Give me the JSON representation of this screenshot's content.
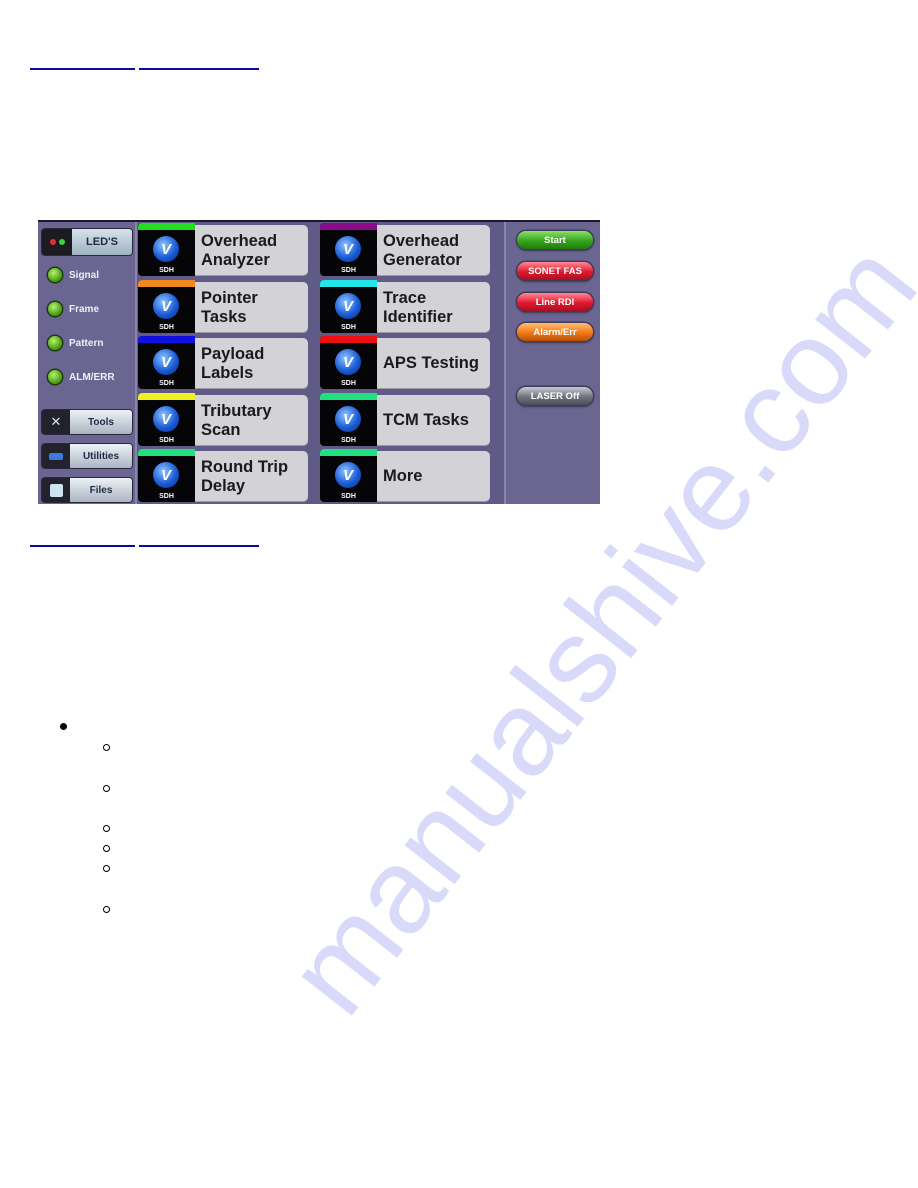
{
  "top_links": [
    {
      "label": ""
    },
    {
      "label": ""
    }
  ],
  "bottom_links": [
    {
      "label": ""
    },
    {
      "label": ""
    }
  ],
  "device": {
    "left_panel": {
      "leds_button": "LED'S",
      "leds": [
        {
          "label": "Signal",
          "color": "#5fbf1e"
        },
        {
          "label": "Frame",
          "color": "#5fbf1e"
        },
        {
          "label": "Pattern",
          "color": "#5fbf1e"
        },
        {
          "label": "ALM/ERR",
          "color": "#5fbf1e"
        }
      ],
      "nav_buttons": [
        {
          "label": "Tools",
          "icon": "tools-icon"
        },
        {
          "label": "Utilities",
          "icon": "utilities-icon"
        },
        {
          "label": "Files",
          "icon": "files-icon"
        }
      ]
    },
    "tiles": [
      {
        "label": "Overhead\nAnalyzer",
        "bar_color": "#22dd22",
        "badge": "SDH"
      },
      {
        "label": "Overhead\nGenerator",
        "bar_color": "#8a0a8a",
        "badge": "SDH"
      },
      {
        "label": "Pointer\nTasks",
        "bar_color": "#f08a20",
        "badge": "SDH"
      },
      {
        "label": "Trace\nIdentifier",
        "bar_color": "#20e8e8",
        "badge": "SDH"
      },
      {
        "label": "Payload\nLabels",
        "bar_color": "#1010e0",
        "badge": "SDH"
      },
      {
        "label": "APS Testing",
        "bar_color": "#ee1010",
        "badge": "SDH"
      },
      {
        "label": "Tributary\nScan",
        "bar_color": "#f0f020",
        "badge": "SDH"
      },
      {
        "label": "TCM Tasks",
        "bar_color": "#20e080",
        "badge": "SDH"
      },
      {
        "label": "Round Trip\nDelay",
        "bar_color": "#20e080",
        "badge": "SDH"
      },
      {
        "label": "More",
        "bar_color": "#20e080",
        "badge": "SDH"
      }
    ],
    "right_panel": {
      "buttons": [
        {
          "label": "Start",
          "style": "green"
        },
        {
          "label": "SONET FAS",
          "style": "red"
        },
        {
          "label": "Line RDI",
          "style": "red"
        },
        {
          "label": "Alarm/Err",
          "style": "orange"
        },
        {
          "label": "LASER Off",
          "style": "gray"
        }
      ]
    }
  },
  "watermark": "manualshive.com"
}
